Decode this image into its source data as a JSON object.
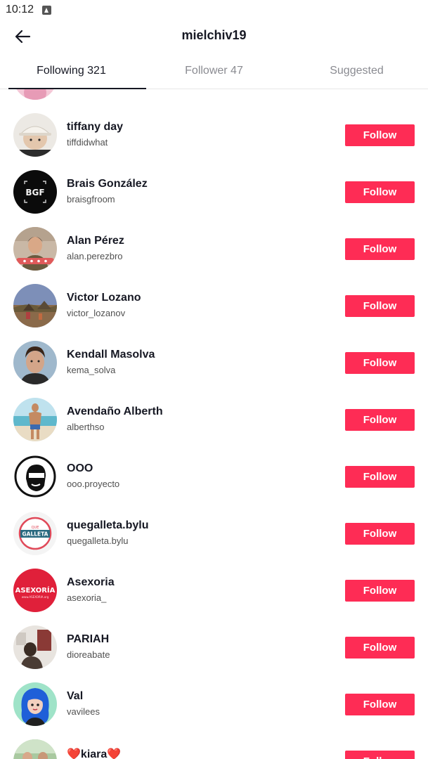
{
  "status": {
    "time": "10:12"
  },
  "header": {
    "title": "mielchiv19"
  },
  "tabs": [
    {
      "label": "Following 321",
      "active": true
    },
    {
      "label": "Follower 47",
      "active": false
    },
    {
      "label": "Suggested",
      "active": false
    }
  ],
  "list": {
    "follow_label": "Follow",
    "users": [
      {
        "name": "",
        "handle": "",
        "avatar_icon": "pink-avatar"
      },
      {
        "name": "tiffany day",
        "handle": "tiffdidwhat",
        "avatar_icon": "person-hat-avatar"
      },
      {
        "name": "Brais González",
        "handle": "braisgfroom",
        "avatar_icon": "bgf-logo-avatar"
      },
      {
        "name": "Alan Pérez",
        "handle": "alan.perezbro",
        "avatar_icon": "person-photo-avatar"
      },
      {
        "name": "Victor Lozano",
        "handle": "victor_lozanov",
        "avatar_icon": "landscape-photo-avatar"
      },
      {
        "name": "Kendall Masolva",
        "handle": "kema_solva",
        "avatar_icon": "portrait-avatar"
      },
      {
        "name": "Avendaño Alberth",
        "handle": "alberthso",
        "avatar_icon": "beach-photo-avatar"
      },
      {
        "name": "OOO",
        "handle": "ooo.proyecto",
        "avatar_icon": "masked-face-logo-avatar"
      },
      {
        "name": "quegalleta.bylu",
        "handle": "quegalleta.bylu",
        "avatar_icon": "galleta-logo-avatar"
      },
      {
        "name": "Asexoria",
        "handle": "asexoria_",
        "avatar_icon": "asexoria-logo-avatar"
      },
      {
        "name": "PARIAH",
        "handle": "dioreabate",
        "avatar_icon": "room-photo-avatar"
      },
      {
        "name": "Val",
        "handle": "vavilees",
        "avatar_icon": "blue-hair-cartoon-avatar"
      },
      {
        "name": "❤️kiara❤️",
        "handle": "",
        "avatar_icon": "group-photo-avatar"
      }
    ]
  },
  "colors": {
    "accent": "#fe2c55",
    "text": "#161823",
    "muted": "#8a8b91"
  },
  "brand_logos": {
    "bgf": "BGF",
    "galleta_top": "QUE",
    "galleta_main": "GALLETA",
    "asexoria": "ASEXORÍA",
    "asexoria_sub": "www.ASEXORIA.org"
  }
}
